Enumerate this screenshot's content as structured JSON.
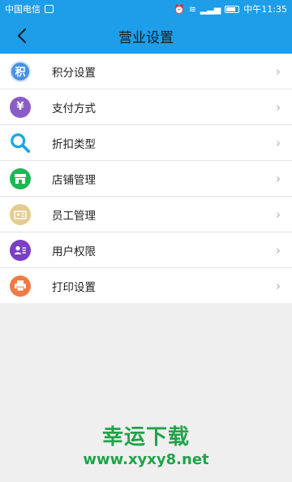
{
  "status_bar": {
    "carrier": "中国电信",
    "time": "中午11:35"
  },
  "navbar": {
    "title": "营业设置",
    "back_icon": "chevron-left-icon"
  },
  "menu": {
    "items": [
      {
        "label": "积分设置",
        "icon": "points-icon",
        "icon_char": "积",
        "color": "#4a90e2"
      },
      {
        "label": "支付方式",
        "icon": "yen-icon",
        "icon_char": "¥",
        "color": "#8b5cc8"
      },
      {
        "label": "折扣类型",
        "icon": "search-icon",
        "icon_char": "",
        "color": "#18a7e0"
      },
      {
        "label": "店铺管理",
        "icon": "store-icon",
        "icon_char": "",
        "color": "#1fb655"
      },
      {
        "label": "员工管理",
        "icon": "staff-icon",
        "icon_char": "",
        "color": "#e3cc8f"
      },
      {
        "label": "用户权限",
        "icon": "user-card-icon",
        "icon_char": "",
        "color": "#7a3fc4"
      },
      {
        "label": "打印设置",
        "icon": "printer-icon",
        "icon_char": "",
        "color": "#f07a46"
      }
    ]
  },
  "watermark": {
    "title": "幸运下载",
    "url": "www.xyxy8.net"
  }
}
